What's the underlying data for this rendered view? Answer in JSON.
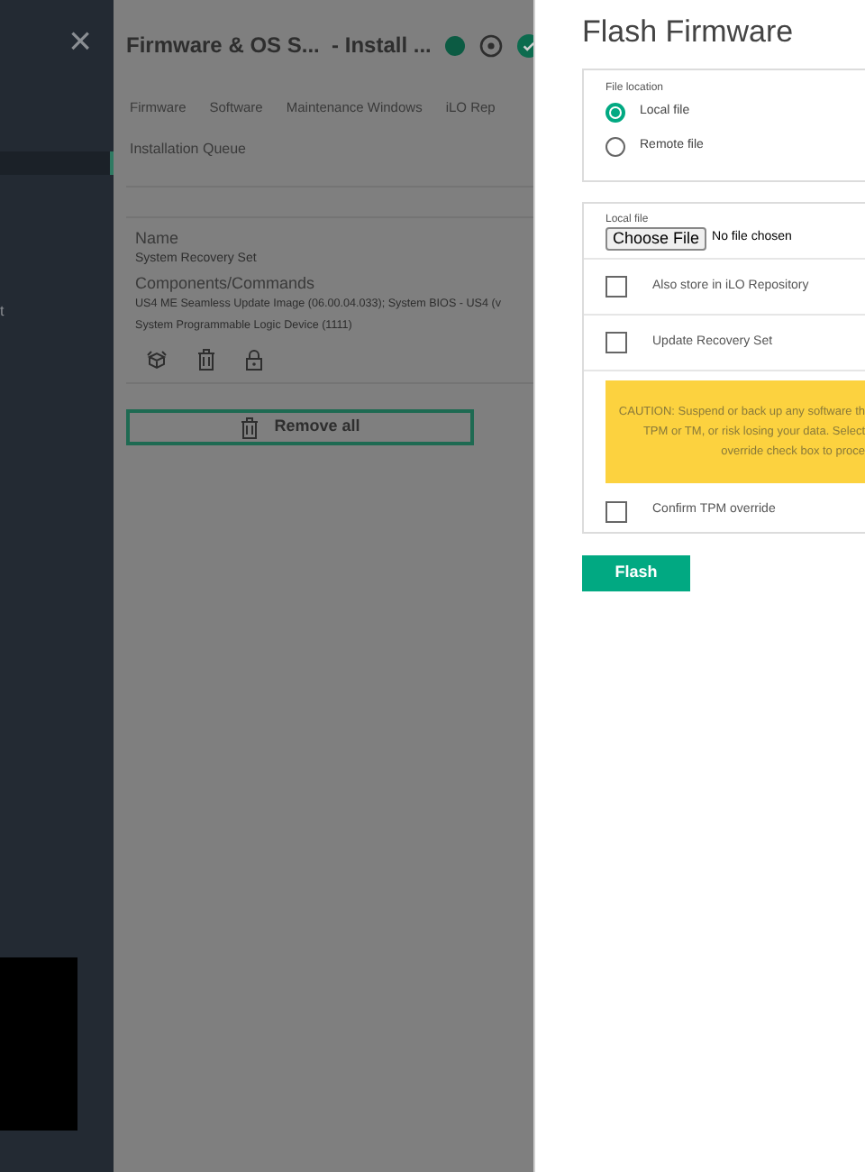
{
  "sidebar": {
    "close_icon": "×",
    "fragment_text": "t"
  },
  "page": {
    "title": "Firmware & OS S...  - Install ...",
    "tabs": [
      {
        "label": "Firmware"
      },
      {
        "label": "Software"
      },
      {
        "label": "Maintenance Windows"
      },
      {
        "label": "iLO Rep"
      },
      {
        "label": "Installation Queue"
      }
    ],
    "queue_item": {
      "name_label": "Name",
      "name": "System Recovery Set",
      "components_label": "Components/Commands",
      "components": [
        "US4 ME Seamless Update Image (06.00.04.033); System BIOS - US4 (v",
        "System Programmable Logic Device (1111)"
      ]
    },
    "remove_all": "Remove all"
  },
  "dialog": {
    "title": "Flash Firmware",
    "file_location": {
      "label": "File location",
      "options": [
        {
          "label": "Local file",
          "selected": true
        },
        {
          "label": "Remote file",
          "selected": false
        }
      ]
    },
    "local_file": {
      "label": "Local file",
      "button": "Choose File",
      "status": "No file chosen"
    },
    "checkboxes": [
      {
        "label": "Also store in iLO Repository",
        "checked": false
      },
      {
        "label": "Update Recovery Set",
        "checked": false
      }
    ],
    "caution": [
      "CAUTION: Suspend or back up any software th",
      "TPM or TM, or risk losing your data. Select",
      "override check box to proce"
    ],
    "confirm": {
      "label": "Confirm TPM override",
      "checked": false
    },
    "flash_button": "Flash"
  }
}
